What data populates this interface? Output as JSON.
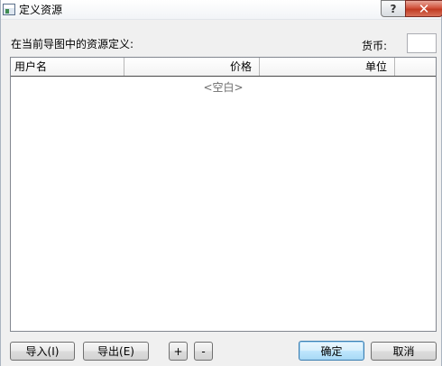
{
  "window": {
    "title": "定义资源",
    "help_glyph": "?",
    "close_glyph": "✕"
  },
  "header": {
    "caption": "在当前导图中的资源定义:",
    "currency_label": "货币:",
    "currency_value": ""
  },
  "table": {
    "columns": [
      "用户名",
      "价格",
      "单位"
    ],
    "empty_text": "<空白>"
  },
  "buttons": {
    "import": "导入(I)",
    "export": "导出(E)",
    "add": "+",
    "remove": "-",
    "ok": "确定",
    "cancel": "取消"
  },
  "colors": {
    "close_button": "#c94a32",
    "default_button_border": "#3c7fb1"
  }
}
